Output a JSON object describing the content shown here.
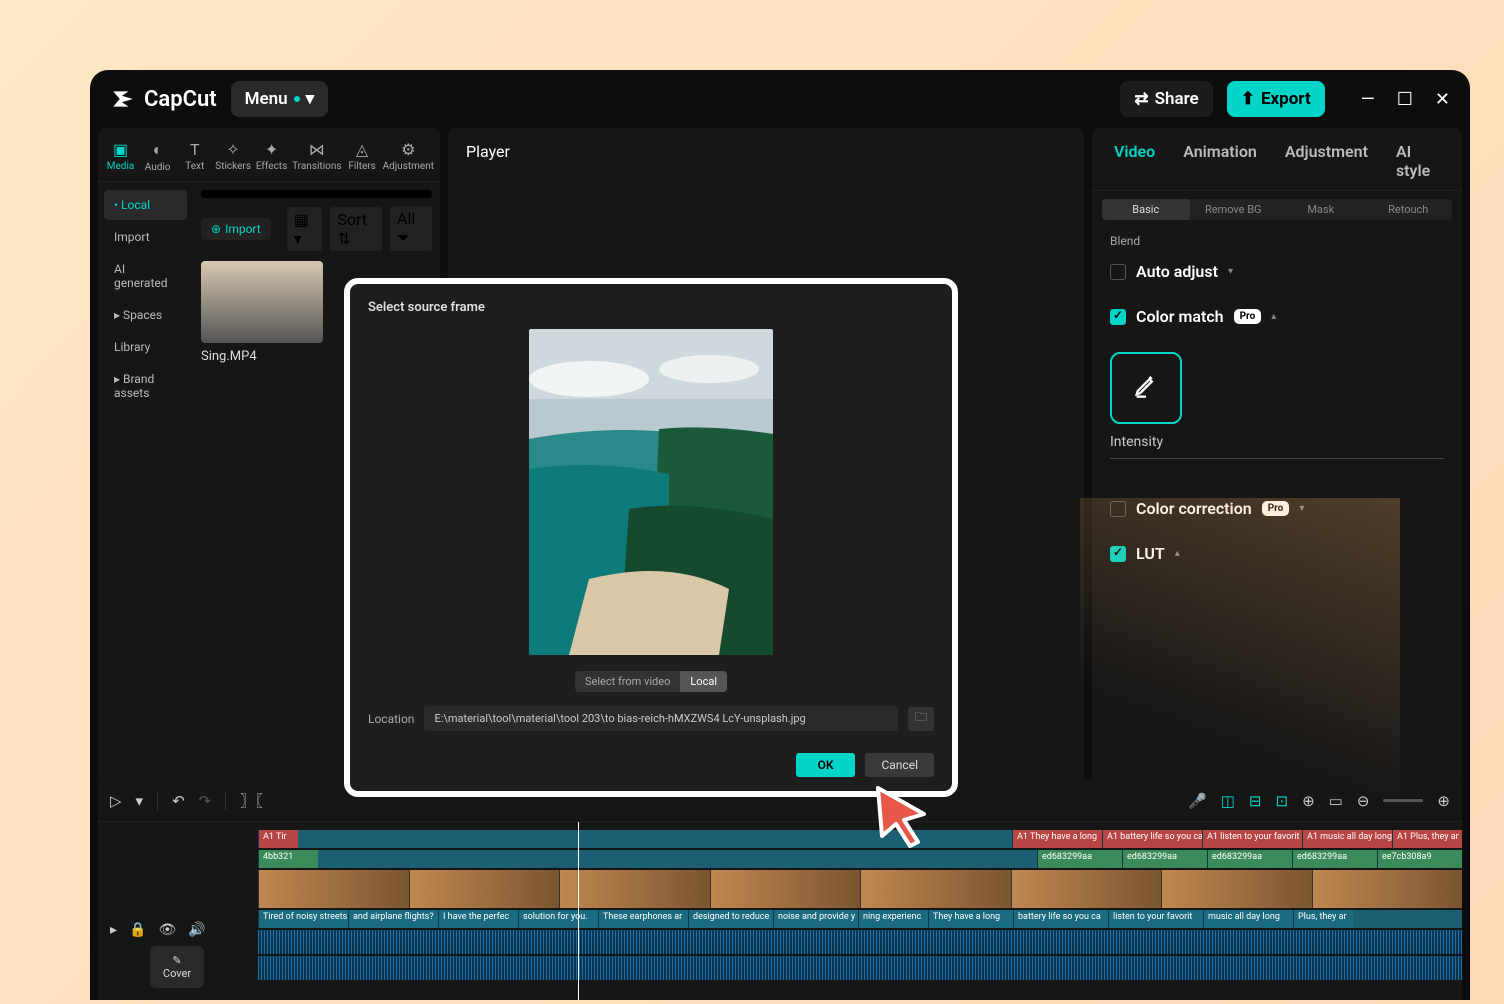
{
  "app": {
    "name": "CapCut",
    "menu_label": "Menu"
  },
  "titlebar": {
    "share": "Share",
    "export": "Export"
  },
  "tool_tabs": [
    {
      "label": "Media",
      "active": true
    },
    {
      "label": "Audio"
    },
    {
      "label": "Text"
    },
    {
      "label": "Stickers"
    },
    {
      "label": "Effects"
    },
    {
      "label": "Transitions"
    },
    {
      "label": "Filters"
    },
    {
      "label": "Adjustment"
    }
  ],
  "sources": [
    {
      "label": "Local",
      "active": true
    },
    {
      "label": "Import"
    },
    {
      "label": "AI generated"
    },
    {
      "label": "Spaces"
    },
    {
      "label": "Library"
    },
    {
      "label": "Brand assets"
    }
  ],
  "import_btn": "Import",
  "filters": {
    "sort": "Sort",
    "all": "All"
  },
  "clip_name": "Sing.MP4",
  "player": {
    "title": "Player"
  },
  "prop_tabs": [
    {
      "label": "Video",
      "active": true
    },
    {
      "label": "Animation"
    },
    {
      "label": "Adjustment"
    },
    {
      "label": "AI style"
    }
  ],
  "sub_tabs": [
    {
      "label": "Basic",
      "active": true
    },
    {
      "label": "Remove BG"
    },
    {
      "label": "Mask"
    },
    {
      "label": "Retouch"
    }
  ],
  "props": {
    "blend": "Blend",
    "auto_adjust": "Auto adjust",
    "color_match": "Color match",
    "pro": "Pro",
    "intensity": "Intensity",
    "color_correction": "Color correction",
    "lut": "LUT"
  },
  "modal": {
    "title": "Select source frame",
    "select_from_video": "Select from video",
    "local": "Local",
    "location_label": "Location",
    "location_value": "E:\\material\\tool\\material\\tool 203\\to bias-reich-hMXZWS4 LcY-unsplash.jpg",
    "ok": "OK",
    "cancel": "Cancel"
  },
  "timeline": {
    "cover": "Cover",
    "captions_row1": [
      "A1 Tir",
      "A1 They have a long",
      "A1 battery life so you ca",
      "A1 listen to your favorit",
      "A1 music all day long",
      "A1 Plus, they ar"
    ],
    "captions_row2": [
      "Tired of noisy streets",
      "and airplane flights?",
      "I have the perfec",
      "solution for you.",
      "These earphones ar",
      "designed to reduce",
      "noise and provide y",
      "ning experienc",
      "They have a long",
      "battery life so you ca",
      "listen to your favorit",
      "music all day long",
      "Plus, they ar"
    ]
  }
}
